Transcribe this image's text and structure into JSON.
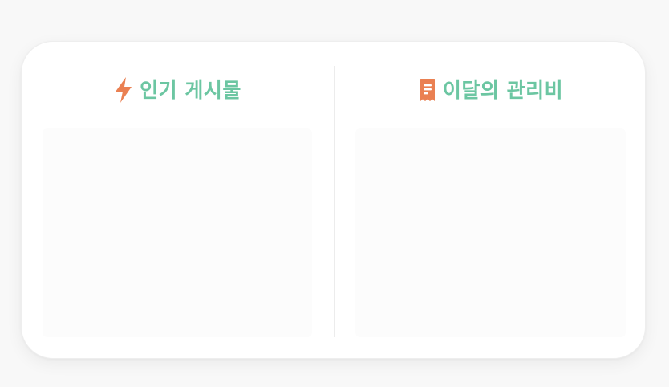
{
  "dashboard": {
    "popular_posts": {
      "title": "인기 게시물",
      "icon": "lightning-icon",
      "icon_color": "#ea8052"
    },
    "monthly_fee": {
      "title": "이달의 관리비",
      "icon": "receipt-icon",
      "icon_color": "#ea8052"
    },
    "accent_color": "#6cc6a2"
  }
}
